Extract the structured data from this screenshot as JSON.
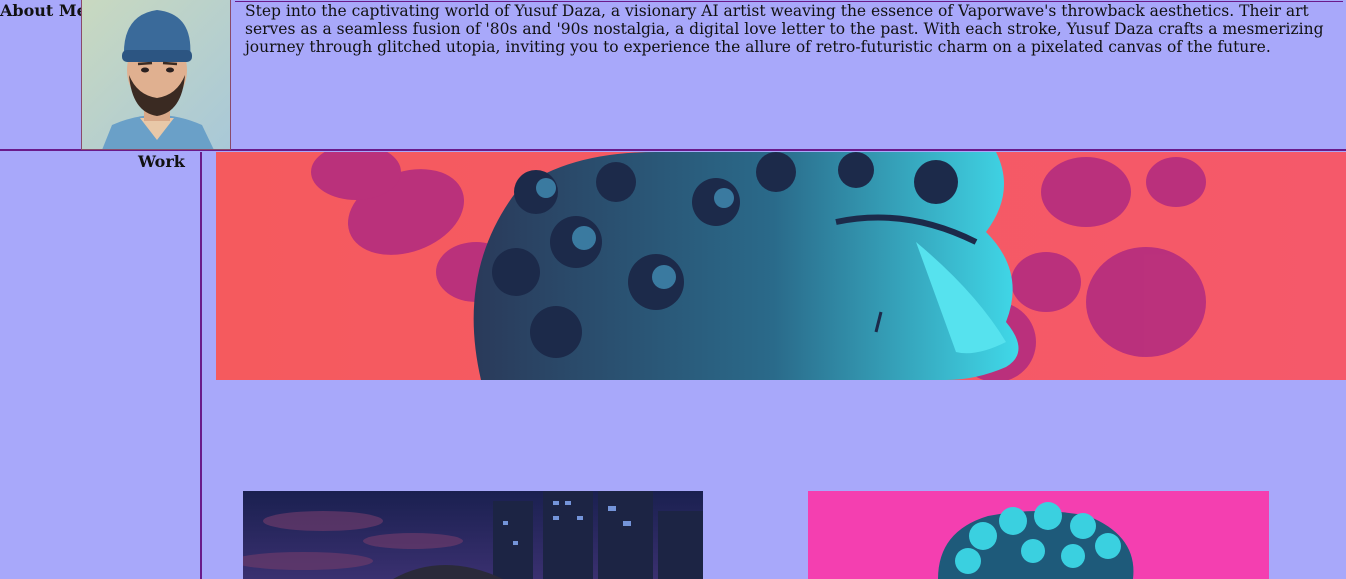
{
  "about": {
    "label": "About Me",
    "bio": "Step into the captivating world of Yusuf Daza, a visionary AI artist weaving the essence of Vaporwave's throwback aesthetics. Their art serves as a seamless fusion of '80s and '90s nostalgia, a digital love letter to the past. With each stroke, Yusuf Daza crafts a mesmerizing journey through glitched utopia, inviting you to experience the allure of retro-futuristic charm on a pixelated canvas of the future."
  },
  "work": {
    "label": "Work"
  },
  "colors": {
    "page_background": "#a8a8fa",
    "divider": "#6a1a8a",
    "hero_background": "#f25a66",
    "thumb_right_background": "#f43fb0",
    "statue_cyan": "#38d0e0"
  }
}
